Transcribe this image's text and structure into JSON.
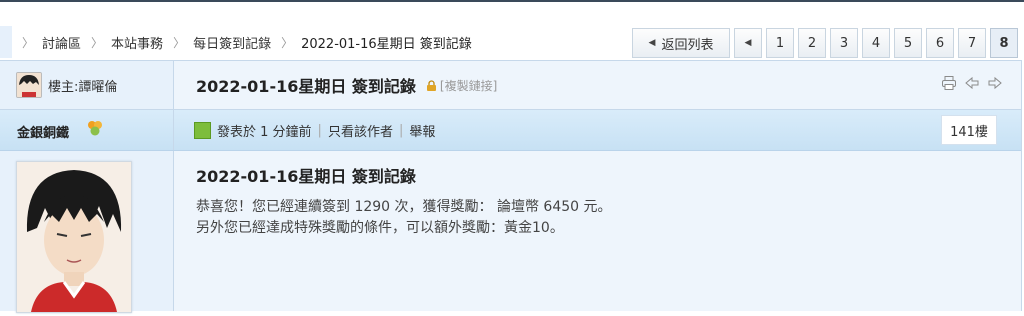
{
  "breadcrumb": {
    "items": [
      "討論區",
      "本站事務",
      "每日簽到記錄",
      "2022-01-16星期日 簽到記錄"
    ]
  },
  "pagination": {
    "back_label": "返回列表",
    "pages": [
      "1",
      "2",
      "3",
      "4",
      "5",
      "6",
      "7"
    ],
    "current": "8"
  },
  "post": {
    "author_prefix": "樓主: ",
    "author": "譚曜倫",
    "title": "2022-01-16星期日 簽到記錄",
    "copy_link": "[複製鏈接]",
    "username": "金銀銅鐵",
    "posted_label": "發表於 1 分鐘前",
    "author_only_label": "只看該作者",
    "report_label": "舉報",
    "floor": "141樓",
    "content_title": "2022-01-16星期日 簽到記錄",
    "content_lines": [
      "恭喜您！您已經連續簽到 1290 次，獲得獎勵： 論壇幣 6450 元。",
      "另外您已經達成特殊獎勵的條件，可以額外獎勵：黃金10。"
    ]
  },
  "icons": [
    "chevron-right-icon",
    "triangle-left-icon",
    "user-avatar-icon",
    "lock-icon",
    "printer-icon",
    "arrow-left-icon",
    "arrow-right-icon",
    "medal-icon",
    "post-icon"
  ],
  "colors": {
    "band": "#d9ecfa",
    "background_right": "#eef5fc",
    "background_left": "#e7f1fb",
    "border": "#c6d8ea",
    "medal": "#f0a020",
    "post_icon": "#7dbd3c"
  }
}
